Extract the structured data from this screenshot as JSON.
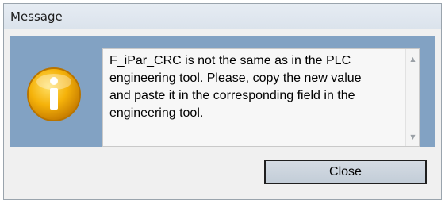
{
  "dialog": {
    "title": "Message",
    "message": "F_iPar_CRC is not the same as in the PLC\nengineering tool. Please, copy the new value\nand paste it in the corresponding field in the\nengineering tool.",
    "icon": "info-icon",
    "scroll_up_icon": "scroll-up-arrow-icon",
    "scroll_down_icon": "scroll-down-arrow-icon",
    "close_label": "Close",
    "colors": {
      "panel_background": "#82a2c3",
      "icon_fill": "#f5b20a",
      "button_border": "#1f1f1f"
    }
  }
}
